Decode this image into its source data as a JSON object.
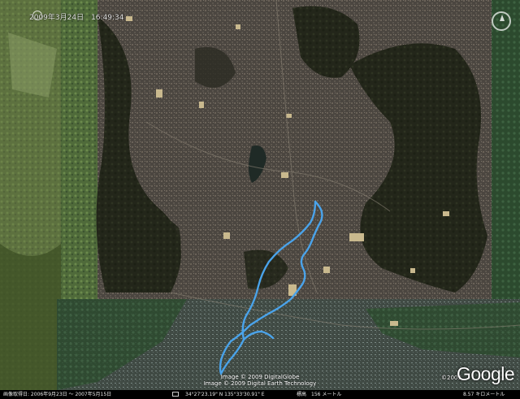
{
  "overlay": {
    "top_date": "2009年3月24日　16:49:34"
  },
  "credits": {
    "line1": "Image © 2009 DigitalGlobe",
    "line2": "Image © 2009 Digital Earth Technology",
    "year": "©2009",
    "logo": "Google"
  },
  "status_bar": {
    "dates": "画像取得日: 2006年9月23日 ～ 2007年5月15日",
    "coordinates": "34°27'23.19\" N   135°33'30.91\" E",
    "elevation": "標高　156 メートル",
    "eye_altitude": "8.57 キロメートル"
  },
  "map": {
    "route_color": "#4aa3ea",
    "icons": [
      "compass-icon",
      "camera-icon"
    ]
  }
}
